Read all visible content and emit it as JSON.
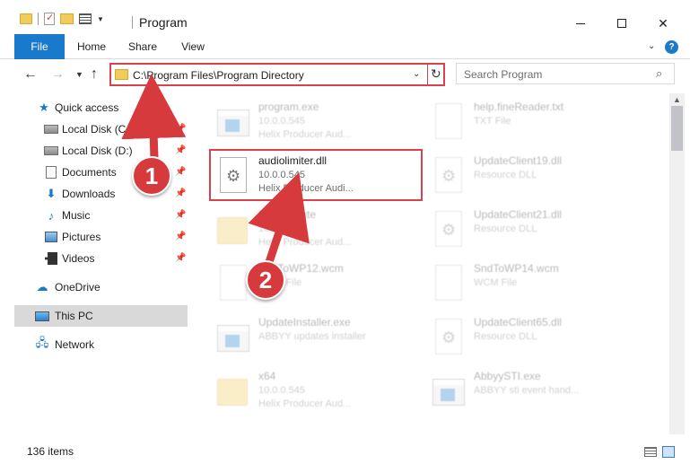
{
  "window": {
    "title": "Program",
    "minimize_icon": "minimize-icon",
    "maximize_icon": "maximize-icon",
    "close_label": "✕"
  },
  "ribbon": {
    "tabs": [
      {
        "label": "File",
        "active": true
      },
      {
        "label": "Home"
      },
      {
        "label": "Share"
      },
      {
        "label": "View"
      }
    ],
    "help_label": "?"
  },
  "address_bar": {
    "path": "C:\\Program Files\\Program Directory",
    "refresh_symbol": "↻"
  },
  "search": {
    "placeholder": "Search Program"
  },
  "sidebar": {
    "items": [
      {
        "label": "Quick access",
        "icon": "star-icon"
      },
      {
        "label": "Local Disk (C:)",
        "icon": "disk-icon",
        "pinned": true
      },
      {
        "label": "Local Disk (D:)",
        "icon": "disk-icon",
        "pinned": true
      },
      {
        "label": "Documents",
        "icon": "document-icon",
        "pinned": true
      },
      {
        "label": "Downloads",
        "icon": "download-icon",
        "pinned": true
      },
      {
        "label": "Music",
        "icon": "music-icon",
        "pinned": true
      },
      {
        "label": "Pictures",
        "icon": "pictures-icon",
        "pinned": true
      },
      {
        "label": "Videos",
        "icon": "videos-icon",
        "pinned": true
      },
      {
        "label": "OneDrive",
        "icon": "cloud-icon"
      },
      {
        "label": "This PC",
        "icon": "computer-icon",
        "selected": true
      },
      {
        "label": "Network",
        "icon": "network-icon"
      }
    ]
  },
  "files": [
    {
      "name": "program.exe",
      "line1": "10.0.0.545",
      "line2": "Helix Producer Aud...",
      "icon": "exe-icon",
      "faded": true
    },
    {
      "name": "help.fineReader.txt",
      "line1": "TXT File",
      "line2": "",
      "icon": "text-file-icon",
      "faded": true
    },
    {
      "name": "audiolimiter.dll",
      "line1": "10.0.0.545",
      "line2": "Helix Producer Audi...",
      "icon": "dll-gear-icon",
      "faded": false
    },
    {
      "name": "UpdateClient19.dll",
      "line1": "Resource DLL",
      "line2": "",
      "icon": "dll-gear-icon",
      "faded": true
    },
    {
      "name": "Redistribute",
      "line1": "10.0.0.545",
      "line2": "Helix Producer Aud...",
      "icon": "folder-icon",
      "faded": true
    },
    {
      "name": "UpdateClient21.dll",
      "line1": "Resource DLL",
      "line2": "",
      "icon": "dll-gear-icon",
      "faded": true
    },
    {
      "name": "SndToWP12.wcm",
      "line1": "WCM File",
      "line2": "",
      "icon": "file-icon",
      "faded": true
    },
    {
      "name": "SndToWP14.wcm",
      "line1": "WCM File",
      "line2": "",
      "icon": "file-icon",
      "faded": true
    },
    {
      "name": "UpdateInstaller.exe",
      "line1": "ABBYY updates installer",
      "line2": "",
      "icon": "exe-icon",
      "faded": true
    },
    {
      "name": "UpdateClient65.dll",
      "line1": "Resource DLL",
      "line2": "",
      "icon": "dll-gear-icon",
      "faded": true
    },
    {
      "name": "x64",
      "line1": "10.0.0.545",
      "line2": "Helix Producer Aud...",
      "icon": "folder-icon",
      "faded": true
    },
    {
      "name": "AbbyySTI.exe",
      "line1": "ABBYY sti event hand...",
      "line2": "",
      "icon": "exe-icon",
      "faded": true
    }
  ],
  "status_bar": {
    "item_count": "136 items"
  },
  "annotations": {
    "step1": "1",
    "step2": "2",
    "color": "#d63a3d"
  },
  "colors": {
    "accent": "#1979ca",
    "highlight": "#d9414c"
  }
}
